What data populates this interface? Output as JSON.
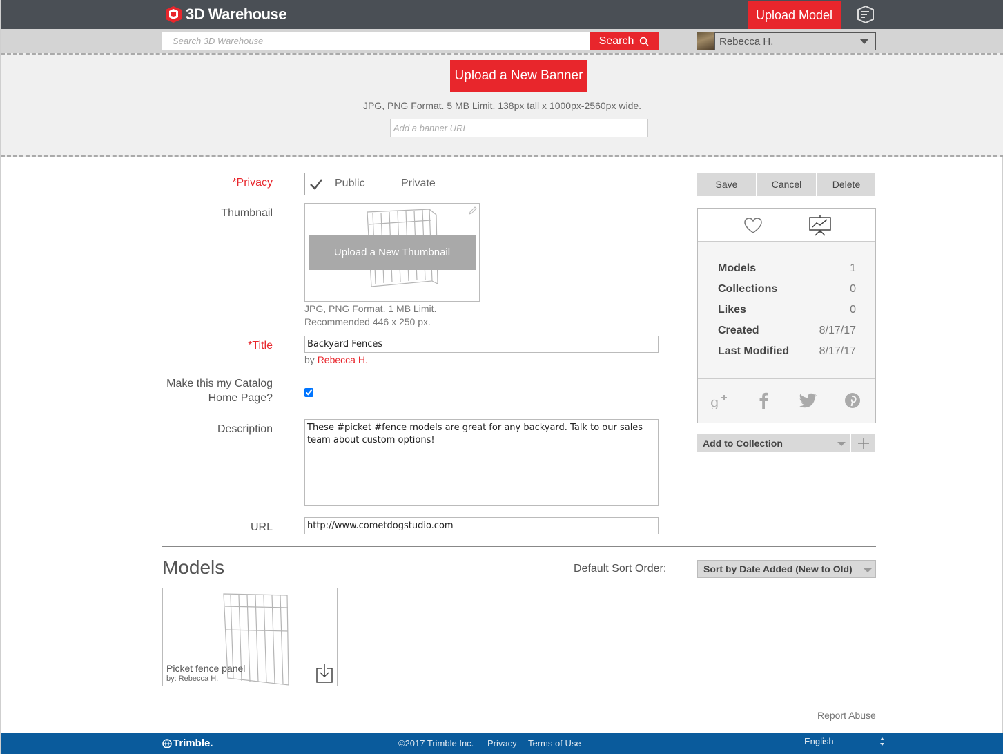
{
  "header": {
    "logo_text": "3D Warehouse",
    "upload_model_label": "Upload Model"
  },
  "search": {
    "placeholder": "Search 3D Warehouse",
    "button_label": "Search"
  },
  "user": {
    "name": "Rebecca H."
  },
  "banner": {
    "upload_label": "Upload a New Banner",
    "info": "JPG, PNG Format. 5 MB Limit. 138px tall x 1000px-2560px wide.",
    "url_placeholder": "Add a banner URL"
  },
  "form": {
    "privacy_label": "*Privacy",
    "public_label": "Public",
    "private_label": "Private",
    "public_checked": true,
    "private_checked": false,
    "thumbnail_label": "Thumbnail",
    "thumbnail_upload_label": "Upload a New Thumbnail",
    "thumbnail_note_1": "JPG, PNG Format. 1 MB Limit.",
    "thumbnail_note_2": "Recommended 446 x 250 px.",
    "title_label": "*Title",
    "title_value": "Backyard Fences",
    "by_prefix": "by",
    "by_name": "Rebecca H.",
    "catalog_label_1": "Make this my Catalog",
    "catalog_label_2": "Home Page?",
    "catalog_checked": true,
    "description_label": "Description",
    "description_value": "These #picket #fence models are great for any backyard. Talk to our sales team about custom options!",
    "url_label": "URL",
    "url_value": "http://www.cometdogstudio.com"
  },
  "actions": {
    "save_label": "Save",
    "cancel_label": "Cancel",
    "delete_label": "Delete"
  },
  "stats": [
    {
      "label": "Models",
      "value": "1"
    },
    {
      "label": "Collections",
      "value": "0"
    },
    {
      "label": "Likes",
      "value": "0"
    },
    {
      "label": "Created",
      "value": "8/17/17"
    },
    {
      "label": "Last Modified",
      "value": "8/17/17"
    }
  ],
  "collection": {
    "add_label": "Add to Collection"
  },
  "models_section": {
    "heading": "Models",
    "sort_label": "Default Sort Order:",
    "sort_value": "Sort by Date Added (New to Old)",
    "items": [
      {
        "name": "Picket fence panel",
        "by": "by: Rebecca H."
      }
    ]
  },
  "report_abuse": "Report Abuse",
  "footer": {
    "brand": "Trimble.",
    "copyright": "©2017 Trimble Inc.",
    "privacy": "Privacy",
    "terms": "Terms of Use",
    "language": "English"
  },
  "colors": {
    "brand_red": "#e8262c",
    "header_bg": "#4a4f55",
    "footer_bg": "#0a5b9c"
  }
}
